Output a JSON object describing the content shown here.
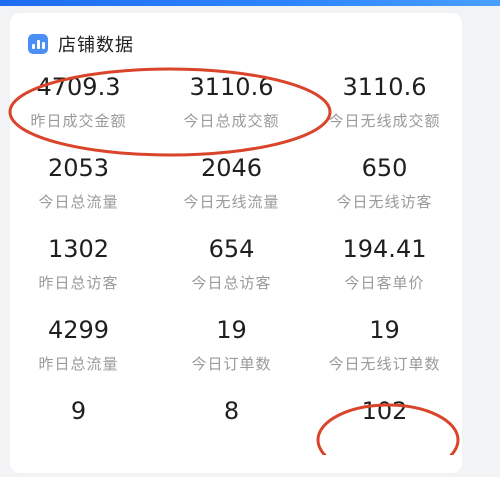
{
  "card": {
    "title": "店铺数据",
    "icon": "bar-chart-icon"
  },
  "metrics": [
    [
      {
        "value": "4709.3",
        "label": "昨日成交金额"
      },
      {
        "value": "3110.6",
        "label": "今日总成交额"
      },
      {
        "value": "3110.6",
        "label": "今日无线成交额"
      }
    ],
    [
      {
        "value": "2053",
        "label": "今日总流量"
      },
      {
        "value": "2046",
        "label": "今日无线流量"
      },
      {
        "value": "650",
        "label": "今日无线访客"
      }
    ],
    [
      {
        "value": "1302",
        "label": "昨日总访客"
      },
      {
        "value": "654",
        "label": "今日总访客"
      },
      {
        "value": "194.41",
        "label": "今日客单价"
      }
    ],
    [
      {
        "value": "4299",
        "label": "昨日总流量"
      },
      {
        "value": "19",
        "label": "今日订单数"
      },
      {
        "value": "19",
        "label": "今日无线订单数"
      }
    ],
    [
      {
        "value": "9",
        "label": ""
      },
      {
        "value": "8",
        "label": ""
      },
      {
        "value": "102",
        "label": ""
      }
    ]
  ],
  "colors": {
    "accent": "#4a8ff7",
    "annotation": "#d9442b",
    "value_text": "#1f1f1f",
    "label_text": "#9a9a9a"
  }
}
